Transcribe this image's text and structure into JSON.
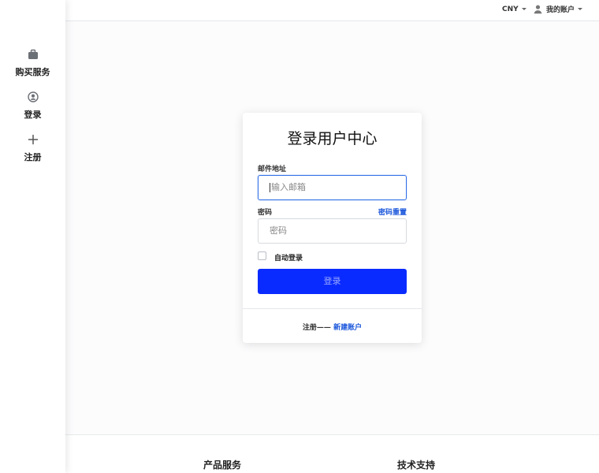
{
  "sidebar": {
    "items": [
      {
        "label": "购买服务",
        "icon": "briefcase-icon"
      },
      {
        "label": "登录",
        "icon": "user-circle-icon"
      },
      {
        "label": "注册",
        "icon": "plus-icon"
      }
    ]
  },
  "topbar": {
    "currency": "CNY",
    "account": "我的账户",
    "account_icon": "user-icon"
  },
  "login": {
    "title": "登录用户中心",
    "email_label": "邮件地址",
    "email_placeholder": "输入邮箱",
    "password_label": "密码",
    "reset_link": "密码重置",
    "password_placeholder": "密码",
    "remember_label": "自动登录",
    "submit_label": "登录",
    "register_prefix": "注册—— ",
    "register_link": "新建账户"
  },
  "footer": {
    "col1_title": "产品服务",
    "col2_title": "技术支持"
  },
  "colors": {
    "accent": "#0a2bff",
    "link": "#1a56db",
    "focus_border": "#2f6fe6"
  }
}
